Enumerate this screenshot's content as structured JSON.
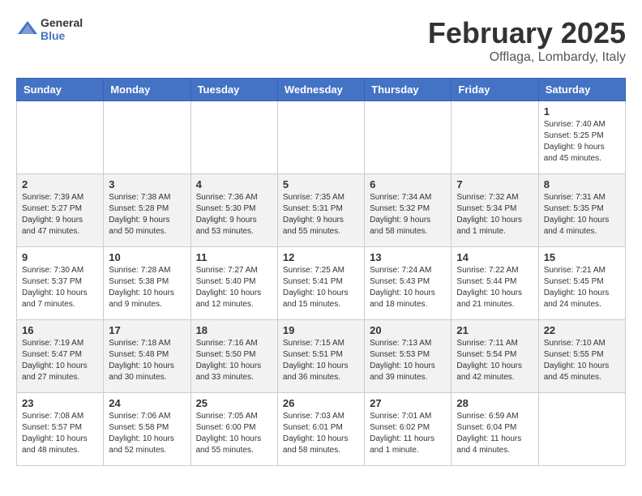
{
  "header": {
    "logo_general": "General",
    "logo_blue": "Blue",
    "title": "February 2025",
    "location": "Offlaga, Lombardy, Italy"
  },
  "days_of_week": [
    "Sunday",
    "Monday",
    "Tuesday",
    "Wednesday",
    "Thursday",
    "Friday",
    "Saturday"
  ],
  "weeks": [
    [
      {
        "day": "",
        "info": ""
      },
      {
        "day": "",
        "info": ""
      },
      {
        "day": "",
        "info": ""
      },
      {
        "day": "",
        "info": ""
      },
      {
        "day": "",
        "info": ""
      },
      {
        "day": "",
        "info": ""
      },
      {
        "day": "1",
        "info": "Sunrise: 7:40 AM\nSunset: 5:25 PM\nDaylight: 9 hours and 45 minutes."
      }
    ],
    [
      {
        "day": "2",
        "info": "Sunrise: 7:39 AM\nSunset: 5:27 PM\nDaylight: 9 hours and 47 minutes."
      },
      {
        "day": "3",
        "info": "Sunrise: 7:38 AM\nSunset: 5:28 PM\nDaylight: 9 hours and 50 minutes."
      },
      {
        "day": "4",
        "info": "Sunrise: 7:36 AM\nSunset: 5:30 PM\nDaylight: 9 hours and 53 minutes."
      },
      {
        "day": "5",
        "info": "Sunrise: 7:35 AM\nSunset: 5:31 PM\nDaylight: 9 hours and 55 minutes."
      },
      {
        "day": "6",
        "info": "Sunrise: 7:34 AM\nSunset: 5:32 PM\nDaylight: 9 hours and 58 minutes."
      },
      {
        "day": "7",
        "info": "Sunrise: 7:32 AM\nSunset: 5:34 PM\nDaylight: 10 hours and 1 minute."
      },
      {
        "day": "8",
        "info": "Sunrise: 7:31 AM\nSunset: 5:35 PM\nDaylight: 10 hours and 4 minutes."
      }
    ],
    [
      {
        "day": "9",
        "info": "Sunrise: 7:30 AM\nSunset: 5:37 PM\nDaylight: 10 hours and 7 minutes."
      },
      {
        "day": "10",
        "info": "Sunrise: 7:28 AM\nSunset: 5:38 PM\nDaylight: 10 hours and 9 minutes."
      },
      {
        "day": "11",
        "info": "Sunrise: 7:27 AM\nSunset: 5:40 PM\nDaylight: 10 hours and 12 minutes."
      },
      {
        "day": "12",
        "info": "Sunrise: 7:25 AM\nSunset: 5:41 PM\nDaylight: 10 hours and 15 minutes."
      },
      {
        "day": "13",
        "info": "Sunrise: 7:24 AM\nSunset: 5:43 PM\nDaylight: 10 hours and 18 minutes."
      },
      {
        "day": "14",
        "info": "Sunrise: 7:22 AM\nSunset: 5:44 PM\nDaylight: 10 hours and 21 minutes."
      },
      {
        "day": "15",
        "info": "Sunrise: 7:21 AM\nSunset: 5:45 PM\nDaylight: 10 hours and 24 minutes."
      }
    ],
    [
      {
        "day": "16",
        "info": "Sunrise: 7:19 AM\nSunset: 5:47 PM\nDaylight: 10 hours and 27 minutes."
      },
      {
        "day": "17",
        "info": "Sunrise: 7:18 AM\nSunset: 5:48 PM\nDaylight: 10 hours and 30 minutes."
      },
      {
        "day": "18",
        "info": "Sunrise: 7:16 AM\nSunset: 5:50 PM\nDaylight: 10 hours and 33 minutes."
      },
      {
        "day": "19",
        "info": "Sunrise: 7:15 AM\nSunset: 5:51 PM\nDaylight: 10 hours and 36 minutes."
      },
      {
        "day": "20",
        "info": "Sunrise: 7:13 AM\nSunset: 5:53 PM\nDaylight: 10 hours and 39 minutes."
      },
      {
        "day": "21",
        "info": "Sunrise: 7:11 AM\nSunset: 5:54 PM\nDaylight: 10 hours and 42 minutes."
      },
      {
        "day": "22",
        "info": "Sunrise: 7:10 AM\nSunset: 5:55 PM\nDaylight: 10 hours and 45 minutes."
      }
    ],
    [
      {
        "day": "23",
        "info": "Sunrise: 7:08 AM\nSunset: 5:57 PM\nDaylight: 10 hours and 48 minutes."
      },
      {
        "day": "24",
        "info": "Sunrise: 7:06 AM\nSunset: 5:58 PM\nDaylight: 10 hours and 52 minutes."
      },
      {
        "day": "25",
        "info": "Sunrise: 7:05 AM\nSunset: 6:00 PM\nDaylight: 10 hours and 55 minutes."
      },
      {
        "day": "26",
        "info": "Sunrise: 7:03 AM\nSunset: 6:01 PM\nDaylight: 10 hours and 58 minutes."
      },
      {
        "day": "27",
        "info": "Sunrise: 7:01 AM\nSunset: 6:02 PM\nDaylight: 11 hours and 1 minute."
      },
      {
        "day": "28",
        "info": "Sunrise: 6:59 AM\nSunset: 6:04 PM\nDaylight: 11 hours and 4 minutes."
      },
      {
        "day": "",
        "info": ""
      }
    ]
  ]
}
